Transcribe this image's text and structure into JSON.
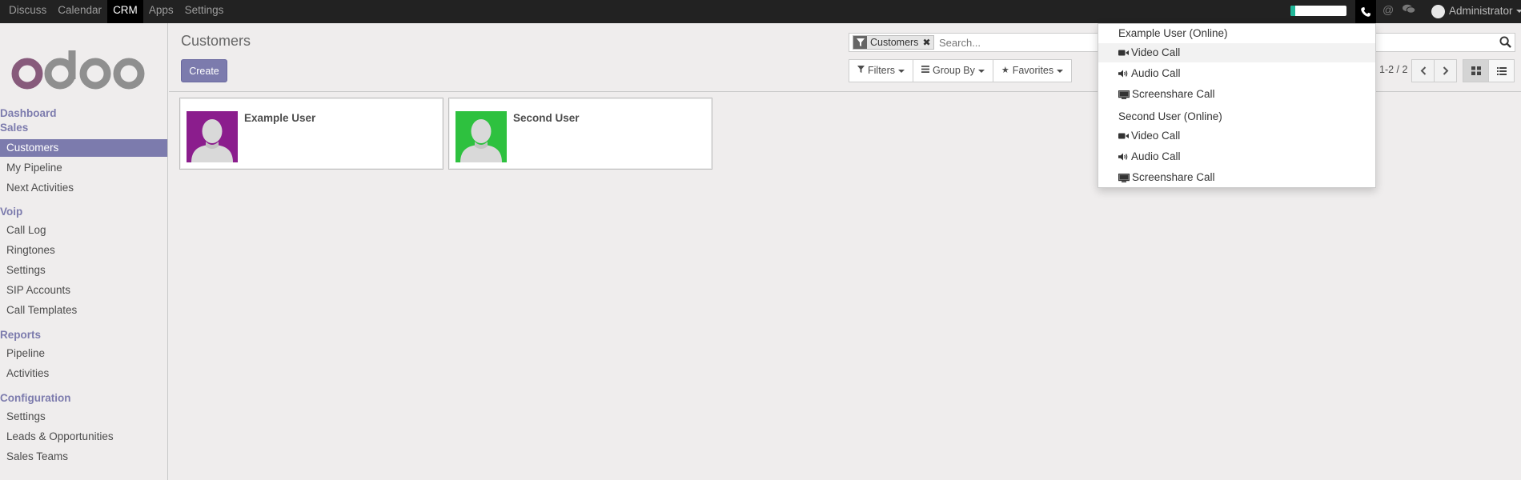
{
  "topnav": {
    "items": [
      "Discuss",
      "Calendar",
      "CRM",
      "Apps",
      "Settings"
    ],
    "active_index": 2
  },
  "systray": {
    "progress": 0.08,
    "user_name": "Administrator",
    "icons": [
      "phone-icon",
      "at-icon",
      "chat-icon"
    ]
  },
  "sidebar": {
    "logo_text": "odoo",
    "sections": [
      {
        "label": "Dashboard"
      },
      {
        "label": "Sales",
        "items": [
          "Customers",
          "My Pipeline",
          "Next Activities"
        ]
      },
      {
        "label": "Voip",
        "items": [
          "Call Log",
          "Ringtones",
          "Settings",
          "SIP Accounts",
          "Call Templates"
        ]
      },
      {
        "label": "Reports",
        "items": [
          "Pipeline",
          "Activities"
        ]
      },
      {
        "label": "Configuration",
        "items": [
          "Settings",
          "Leads & Opportunities",
          "Sales Teams"
        ]
      }
    ],
    "active_item": "Customers"
  },
  "control_panel": {
    "breadcrumb": "Customers",
    "create_label": "Create",
    "search": {
      "facet": "Customers",
      "placeholder": "Search..."
    },
    "filters_label": "Filters",
    "group_by_label": "Group By",
    "favorites_label": "Favorites",
    "pager": "1-2 / 2"
  },
  "kanban": {
    "cards": [
      {
        "name": "Example User",
        "avatar_color": "#8b1d8d"
      },
      {
        "name": "Second User",
        "avatar_color": "#2ec13f"
      }
    ]
  },
  "call_dropdown": {
    "groups": [
      {
        "header": "Example User (Online)",
        "items": [
          "Video Call",
          "Audio Call",
          "Screenshare Call"
        ]
      },
      {
        "header": "Second User (Online)",
        "items": [
          "Video Call",
          "Audio Call",
          "Screenshare Call"
        ]
      }
    ]
  },
  "colors": {
    "brand": "#7c7bad",
    "topbar": "#222222"
  }
}
